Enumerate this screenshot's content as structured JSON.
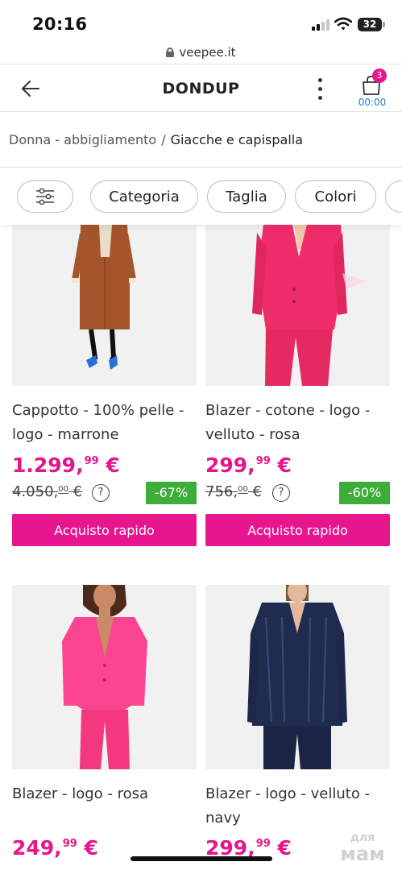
{
  "status": {
    "time": "20:16",
    "battery": "32"
  },
  "browser": {
    "url": "veepee.it"
  },
  "header": {
    "brand": "DONDUP",
    "cart_count": "3",
    "cart_timer": "00:00"
  },
  "breadcrumb": {
    "parent": "Donna - abbigliamento",
    "separator": "/",
    "current": "Giacche e capispalla"
  },
  "filters": {
    "category": "Categoria",
    "size": "Taglia",
    "colors": "Colori"
  },
  "products": [
    {
      "title": "Cappotto - 100% pelle - logo - marrone",
      "price_int": "1.299,",
      "price_dec": "99",
      "currency": "€",
      "old_int": "4.050,",
      "old_dec": "00",
      "discount": "-67%",
      "button": "Acquisto rapido",
      "image": "brown-shearling-coat"
    },
    {
      "title": "Blazer - cotone - logo - velluto - rosa",
      "price_int": "299,",
      "price_dec": "99",
      "currency": "€",
      "old_int": "756,",
      "old_dec": "00",
      "discount": "-60%",
      "button": "Acquisto rapido",
      "image": "pink-corduroy-suit"
    },
    {
      "title": "Blazer - logo - rosa",
      "price_int": "249,",
      "price_dec": "99",
      "currency": "€",
      "image": "pink-blazer"
    },
    {
      "title": "Blazer - logo - velluto - navy",
      "price_int": "299,",
      "price_dec": "99",
      "currency": "€",
      "image": "navy-velvet-blazer"
    }
  ],
  "help_symbol": "?",
  "watermark": {
    "line1": "для",
    "line2": "мам"
  },
  "colors": {
    "accent": "#e5168c",
    "discount": "#3dad3a",
    "link": "#1a7fd6"
  }
}
